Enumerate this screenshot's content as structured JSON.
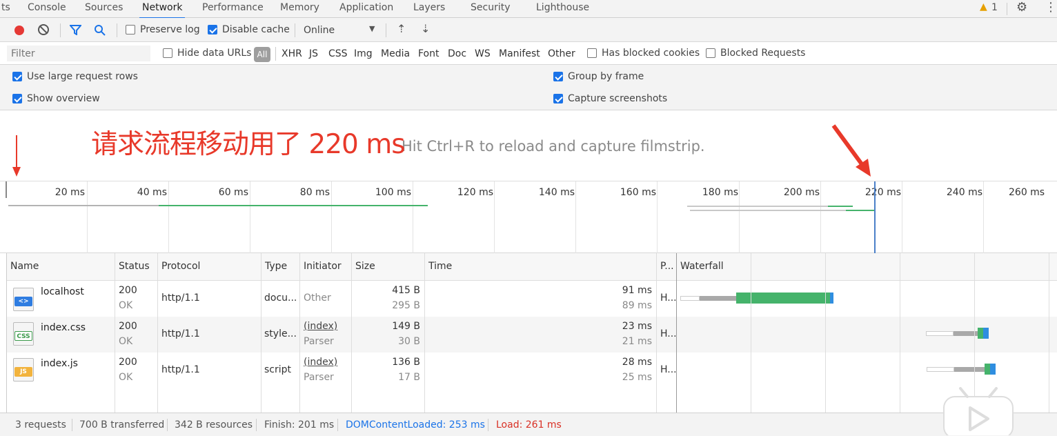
{
  "tabs": [
    "ts",
    "Console",
    "Sources",
    "Network",
    "Performance",
    "Memory",
    "Application",
    "Layers",
    "Security",
    "Lighthouse"
  ],
  "warnings": {
    "count": "1"
  },
  "toolbar": {
    "preserve_log": "Preserve log",
    "disable_cache": "Disable cache",
    "throttle": "Online"
  },
  "filter": {
    "placeholder": "Filter",
    "hide_data_urls": "Hide data URLs",
    "types": [
      "All",
      "XHR",
      "JS",
      "CSS",
      "Img",
      "Media",
      "Font",
      "Doc",
      "WS",
      "Manifest",
      "Other"
    ],
    "has_blocked_cookies": "Has blocked cookies",
    "blocked_requests": "Blocked Requests"
  },
  "settings": {
    "large_rows": "Use large request rows",
    "show_overview": "Show overview",
    "group_by_frame": "Group by frame",
    "capture_screenshots": "Capture screenshots"
  },
  "filmstrip_hint": "Hit Ctrl+R to reload and capture filmstrip.",
  "annotation": "请求流程移动用了 220 ms",
  "timeline_ticks": [
    "20 ms",
    "40 ms",
    "60 ms",
    "80 ms",
    "100 ms",
    "120 ms",
    "140 ms",
    "160 ms",
    "180 ms",
    "200 ms",
    "220 ms",
    "240 ms",
    "260 ms"
  ],
  "columns": [
    "Name",
    "Status",
    "Protocol",
    "Type",
    "Initiator",
    "Size",
    "Time",
    "P...",
    "Waterfall"
  ],
  "requests": [
    {
      "icon": "<>",
      "name": "localhost",
      "status": "200",
      "status_text": "OK",
      "protocol": "http/1.1",
      "type": "docu...",
      "initiator": "Other",
      "initiator_sub": "",
      "size": "415 B",
      "resource": "295 B",
      "time": "91 ms",
      "latency": "89 ms",
      "priority": "H..."
    },
    {
      "icon": "CSS",
      "name": "index.css",
      "status": "200",
      "status_text": "OK",
      "protocol": "http/1.1",
      "type": "style...",
      "initiator": "(index)",
      "initiator_sub": "Parser",
      "size": "149 B",
      "resource": "30 B",
      "time": "23 ms",
      "latency": "21 ms",
      "priority": "H..."
    },
    {
      "icon": "JS",
      "name": "index.js",
      "status": "200",
      "status_text": "OK",
      "protocol": "http/1.1",
      "type": "script",
      "initiator": "(index)",
      "initiator_sub": "Parser",
      "size": "136 B",
      "resource": "17 B",
      "time": "28 ms",
      "latency": "25 ms",
      "priority": "H..."
    }
  ],
  "statusbar": {
    "requests": "3 requests",
    "transferred": "700 B transferred",
    "resources": "342 B resources",
    "finish": "Finish: 201 ms",
    "dcl": "DOMContentLoaded: 253 ms",
    "load": "Load: 261 ms"
  },
  "colors": {
    "accent": "#1a73e8",
    "record": "#e53935",
    "annotation": "#e8392a",
    "dcl": "#1a73e8",
    "load": "#d93025",
    "waterfall_wait": "#a9a9a9",
    "waterfall_download": "#45b36b",
    "waterfall_blue": "#2f8ee0"
  }
}
